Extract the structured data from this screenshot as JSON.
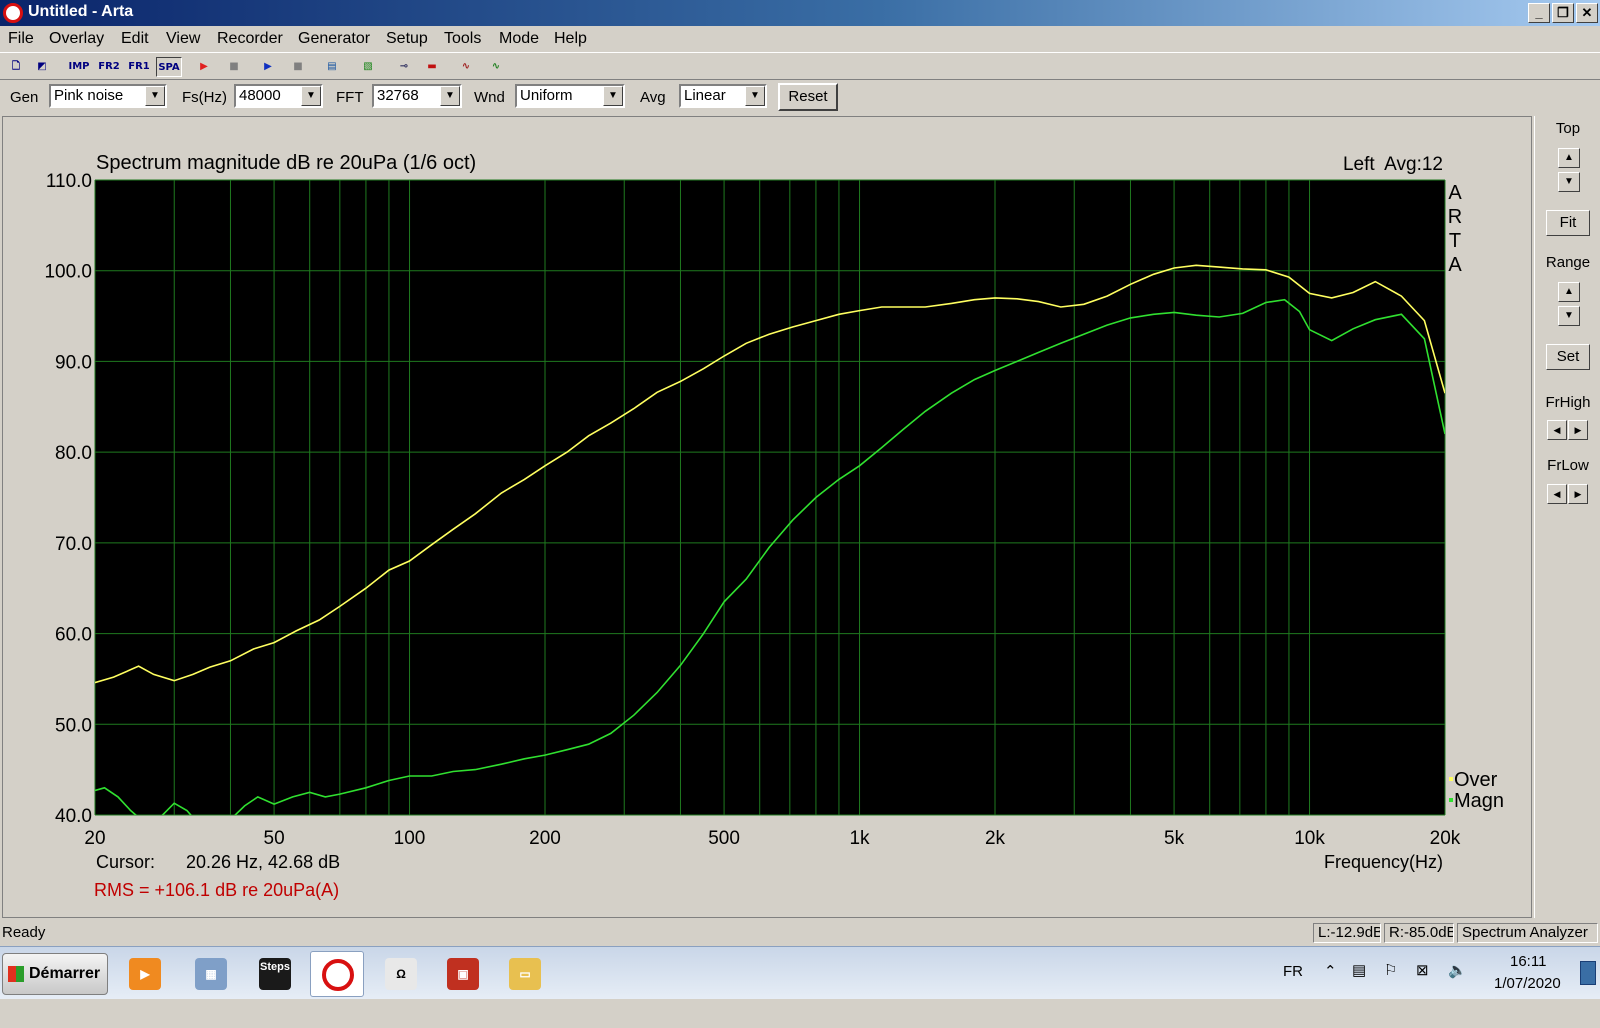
{
  "window": {
    "title": "Untitled - Arta"
  },
  "menu": [
    "File",
    "Overlay",
    "Edit",
    "View",
    "Recorder",
    "Generator",
    "Setup",
    "Tools",
    "Mode",
    "Help"
  ],
  "toolbar": {
    "imp": "IMP",
    "fr2": "FR2",
    "fr1": "FR1",
    "spa": "SPA"
  },
  "controls": {
    "gen_label": "Gen",
    "gen_value": "Pink noise",
    "fs_label": "Fs(Hz)",
    "fs_value": "48000",
    "fft_label": "FFT",
    "fft_value": "32768",
    "wnd_label": "Wnd",
    "wnd_value": "Uniform",
    "avg_label": "Avg",
    "avg_value": "Linear",
    "reset_label": "Reset"
  },
  "side": {
    "top": "Top",
    "fit": "Fit",
    "range": "Range",
    "set": "Set",
    "frhigh": "FrHigh",
    "frlow": "FrLow"
  },
  "plot": {
    "title": "Spectrum magnitude dB re 20uPa (1/6 oct)",
    "channel": "Left  Avg:12",
    "watermark": [
      "A",
      "R",
      "T",
      "A"
    ],
    "cursor_label": "Cursor:",
    "cursor_value": "20.26 Hz, 42.68 dB",
    "rms": "RMS = +106.1 dB re 20uPa(A)",
    "xaxis_label": "Frequency(Hz)"
  },
  "chart_data": {
    "type": "line",
    "xscale": "log",
    "xlim": [
      20,
      20000
    ],
    "ylim": [
      40,
      110
    ],
    "ylabel": "",
    "x_ticks": [
      20,
      50,
      100,
      200,
      500,
      1000,
      2000,
      5000,
      10000,
      20000
    ],
    "x_tick_labels": [
      "20",
      "50",
      "100",
      "200",
      "500",
      "1k",
      "2k",
      "5k",
      "10k",
      "20k"
    ],
    "y_ticks": [
      40,
      50,
      60,
      70,
      80,
      90,
      100,
      110
    ],
    "y_tick_labels": [
      "40.0",
      "50.0",
      "60.0",
      "70.0",
      "80.0",
      "90.0",
      "100.0",
      "110.0"
    ],
    "grid": true,
    "legend_position": "bottom-right",
    "series": [
      {
        "name": "Over",
        "color": "#ffff60",
        "x": [
          20,
          22,
          25,
          27,
          30,
          33,
          36,
          40,
          45,
          50,
          56,
          63,
          70,
          80,
          90,
          100,
          112,
          125,
          140,
          160,
          180,
          200,
          224,
          250,
          280,
          315,
          355,
          400,
          450,
          500,
          560,
          630,
          710,
          800,
          900,
          1000,
          1120,
          1250,
          1400,
          1600,
          1800,
          2000,
          2240,
          2500,
          2800,
          3150,
          3550,
          4000,
          4500,
          5000,
          5600,
          6300,
          7100,
          8000,
          9000,
          10000,
          11200,
          12500,
          14000,
          16000,
          18000,
          20000
        ],
        "y": [
          54.6,
          55.2,
          56.4,
          55.5,
          54.8,
          55.5,
          56.3,
          57.0,
          58.3,
          59.0,
          60.3,
          61.5,
          63.0,
          65.0,
          67.0,
          68.0,
          69.8,
          71.5,
          73.2,
          75.5,
          77.0,
          78.5,
          80.0,
          81.8,
          83.2,
          84.8,
          86.6,
          87.8,
          89.2,
          90.6,
          92.0,
          93.0,
          93.8,
          94.5,
          95.2,
          95.6,
          96.0,
          96.0,
          96.0,
          96.4,
          96.8,
          97.0,
          96.9,
          96.6,
          96.0,
          96.3,
          97.2,
          98.5,
          99.6,
          100.3,
          100.6,
          100.4,
          100.2,
          100.1,
          99.3,
          97.5,
          97.0,
          97.6,
          98.8,
          97.2,
          94.5,
          86.5
        ]
      },
      {
        "name": "Magn",
        "color": "#30e030",
        "x": [
          20,
          21,
          22.5,
          24,
          26,
          28,
          30,
          32,
          34,
          36,
          38,
          40,
          43,
          46,
          50,
          55,
          60,
          65,
          70,
          80,
          90,
          100,
          112,
          125,
          140,
          160,
          180,
          200,
          224,
          250,
          280,
          315,
          355,
          400,
          450,
          500,
          560,
          630,
          710,
          800,
          900,
          1000,
          1120,
          1250,
          1400,
          1600,
          1800,
          2000,
          2240,
          2500,
          2800,
          3150,
          3550,
          4000,
          4500,
          5000,
          5600,
          6300,
          7100,
          8000,
          8800,
          9500,
          10000,
          11200,
          12500,
          14000,
          16000,
          18000,
          20000
        ],
        "y": [
          42.7,
          43.0,
          42.0,
          40.5,
          39.0,
          39.8,
          41.3,
          40.5,
          39.0,
          38.5,
          38.8,
          39.5,
          41.0,
          42.0,
          41.2,
          42.0,
          42.5,
          42.0,
          42.3,
          43.0,
          43.8,
          44.3,
          44.3,
          44.8,
          45.0,
          45.6,
          46.2,
          46.6,
          47.2,
          47.8,
          49.0,
          51.0,
          53.5,
          56.5,
          60.0,
          63.5,
          66.0,
          69.5,
          72.5,
          75.0,
          77.0,
          78.5,
          80.5,
          82.5,
          84.5,
          86.5,
          88.0,
          89.0,
          90.0,
          91.0,
          92.0,
          93.0,
          94.0,
          94.8,
          95.2,
          95.4,
          95.1,
          94.9,
          95.3,
          96.5,
          96.8,
          95.5,
          93.5,
          92.3,
          93.6,
          94.6,
          95.2,
          92.5,
          82.0
        ]
      }
    ]
  },
  "status": {
    "ready": "Ready",
    "left": "L:-12.9dB",
    "right": "R:-85.0dB",
    "mode": "Spectrum Analyzer"
  },
  "taskbar": {
    "start": "Démarrer",
    "steps": "Steps",
    "lang": "FR",
    "time": "16:11",
    "date": "1/07/2020"
  },
  "colors": {
    "plot_bg": "#000000",
    "grid": "#1f7a1f",
    "over": "#ffff60",
    "magn": "#30e030",
    "rms_text": "#c00000"
  }
}
